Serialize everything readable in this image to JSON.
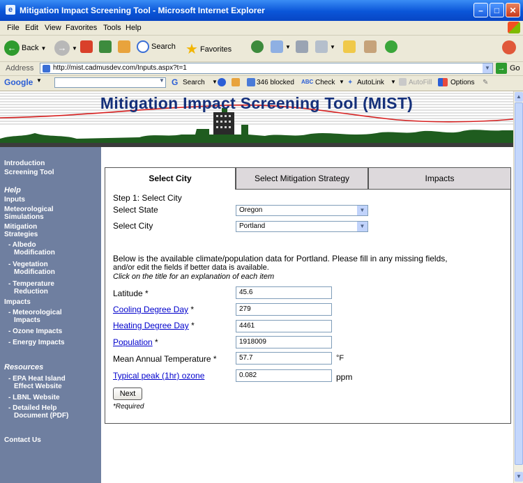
{
  "window": {
    "title": "Mitigation Impact Screening Tool - Microsoft Internet Explorer"
  },
  "menu": [
    "File",
    "Edit",
    "View",
    "Favorites",
    "Tools",
    "Help"
  ],
  "toolbar": {
    "back": "Back",
    "search": "Search",
    "favorites": "Favorites"
  },
  "address": {
    "label": "Address",
    "url": "http://mist.cadmusdev.com/Inputs.aspx?t=1",
    "go": "Go"
  },
  "googlebar": {
    "brand": "Google",
    "search": "Search",
    "blocked": "346 blocked",
    "check": "Check",
    "autolink": "AutoLink",
    "autofill": "AutoFill",
    "options": "Options"
  },
  "banner": {
    "title": "Mitigation Impact Screening Tool (MIST)"
  },
  "sidebar": {
    "items": [
      {
        "label": "Introduction"
      },
      {
        "label": "Screening Tool"
      },
      {
        "label": "Help"
      },
      {
        "label": "Inputs"
      },
      {
        "label": "Meteorological"
      },
      {
        "label": "Simulations"
      },
      {
        "label": "Mitigation"
      },
      {
        "label": "Strategies"
      },
      {
        "label": "- Albedo"
      },
      {
        "label": "Modification"
      },
      {
        "label": "- Vegetation"
      },
      {
        "label": "Modification"
      },
      {
        "label": "- Temperature"
      },
      {
        "label": "Reduction"
      },
      {
        "label": "Impacts"
      },
      {
        "label": "- Meteorological"
      },
      {
        "label": "Impacts"
      },
      {
        "label": "- Ozone Impacts"
      },
      {
        "label": "- Energy Impacts"
      },
      {
        "label": "Resources"
      },
      {
        "label": "- EPA Heat Island"
      },
      {
        "label": "Effect Website"
      },
      {
        "label": "- LBNL Website"
      },
      {
        "label": "- Detailed Help"
      },
      {
        "label": "Document (PDF)"
      },
      {
        "label": "Contact Us"
      }
    ]
  },
  "tabs": [
    {
      "label": "Select City"
    },
    {
      "label": "Select Mitigation Strategy"
    },
    {
      "label": "Impacts"
    }
  ],
  "form": {
    "step": "Step 1: Select City",
    "state_label": "Select State",
    "state_value": "Oregon",
    "city_label": "Select City",
    "city_value": "Portland",
    "info_line1": "Below is the available climate/population data for Portland.  Please fill in any missing fields,",
    "info_line2": "and/or edit the fields if better data is available.",
    "info_line3": "Click on the title for an explanation of each item",
    "latitude_label": "Latitude *",
    "latitude_value": "45.6",
    "cdd_label": "Cooling Degree Day",
    "cdd_req": " *",
    "cdd_value": "279",
    "hdd_label": "Heating Degree Day",
    "hdd_req": "  *",
    "hdd_value": "4461",
    "pop_label": "Population",
    "pop_req": " *",
    "pop_value": "1918009",
    "temp_label": "Mean Annual Temperature *",
    "temp_value": "57.7",
    "temp_unit": "°F",
    "ozone_label": "Typical peak (1hr) ozone",
    "ozone_value": "0.082",
    "ozone_unit": "ppm",
    "next": "Next",
    "required": "*Required"
  }
}
